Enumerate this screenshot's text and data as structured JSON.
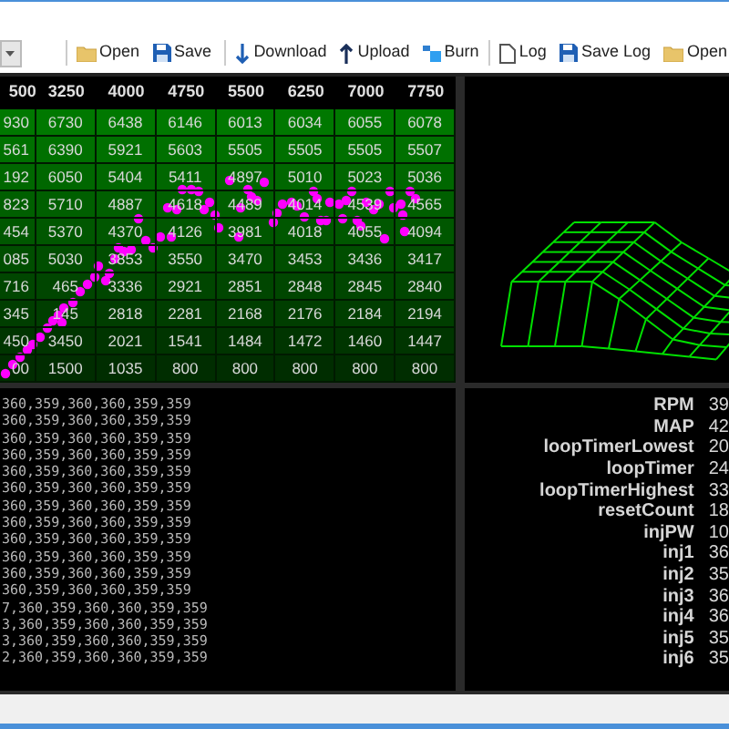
{
  "toolbar": {
    "groups": [
      [
        {
          "label": "Open"
        },
        {
          "label": "Save"
        }
      ],
      [
        {
          "label": "Download"
        },
        {
          "label": "Upload"
        },
        {
          "label": "Burn"
        }
      ],
      [
        {
          "label": "Log"
        },
        {
          "label": "Save Log"
        },
        {
          "label": "Open"
        }
      ]
    ]
  },
  "table": {
    "columns": [
      "500",
      "3250",
      "4000",
      "4750",
      "5500",
      "6250",
      "7000",
      "7750"
    ],
    "rows": [
      [
        "930",
        "6730",
        "6438",
        "6146",
        "6013",
        "6034",
        "6055",
        "6078"
      ],
      [
        "561",
        "6390",
        "5921",
        "5603",
        "5505",
        "5505",
        "5505",
        "5507"
      ],
      [
        "192",
        "6050",
        "5404",
        "5411",
        "4897",
        "5010",
        "5023",
        "5036"
      ],
      [
        "823",
        "5710",
        "4887",
        "4618",
        "4489",
        "4014",
        "4539",
        "4565"
      ],
      [
        "454",
        "5370",
        "4370",
        "4126",
        "3981",
        "4018",
        "4055",
        "4094"
      ],
      [
        "085",
        "5030",
        "3853",
        "3550",
        "3470",
        "3453",
        "3436",
        "3417"
      ],
      [
        "716",
        "465",
        "3336",
        "2921",
        "2851",
        "2848",
        "2845",
        "2840"
      ],
      [
        "345",
        "145",
        "2818",
        "2281",
        "2168",
        "2176",
        "2184",
        "2194"
      ],
      [
        "450",
        "3450",
        "2021",
        "1541",
        "1484",
        "1472",
        "1460",
        "1447"
      ],
      [
        "00",
        "1500",
        "1035",
        "800",
        "800",
        "800",
        "800",
        "800"
      ]
    ]
  },
  "log": {
    "lines": [
      "360,359,360,360,359,359",
      "360,359,360,360,359,359",
      "360,359,360,360,359,359",
      "360,359,360,360,359,359",
      "360,359,360,360,359,359",
      "360,359,360,360,359,359",
      "360,359,360,360,359,359",
      "360,359,360,360,359,359",
      "360,359,360,360,359,359",
      "360,359,360,360,359,359",
      "360,359,360,360,359,359",
      "360,359,360,360,359,359",
      "7,360,359,360,360,359,359",
      "3,360,359,360,360,359,359",
      "3,360,359,360,360,359,359",
      "2,360,359,360,360,359,359"
    ]
  },
  "readings": [
    {
      "label": "RPM",
      "value": "39"
    },
    {
      "label": "MAP",
      "value": "42"
    },
    {
      "label": "loopTimerLowest",
      "value": "20"
    },
    {
      "label": "loopTimer",
      "value": "24"
    },
    {
      "label": "loopTimerHighest",
      "value": "33"
    },
    {
      "label": "resetCount",
      "value": "18"
    },
    {
      "label": "injPW",
      "value": "10"
    },
    {
      "label": "inj1",
      "value": "36"
    },
    {
      "label": "inj2",
      "value": "35"
    },
    {
      "label": "inj3",
      "value": "36"
    },
    {
      "label": "inj4",
      "value": "36"
    },
    {
      "label": "inj5",
      "value": "35"
    },
    {
      "label": "inj6",
      "value": "35"
    }
  ]
}
